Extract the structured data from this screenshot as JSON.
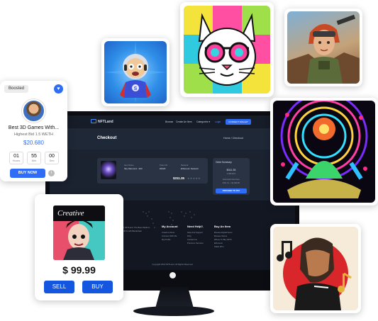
{
  "site": {
    "logo": "NFTLand",
    "nav": [
      "Browse",
      "Create An Item",
      "Categories ▾"
    ],
    "login": "Login",
    "connect": "CONNECT WALLET"
  },
  "checkout": {
    "title": "Checkout",
    "breadcrumb": "Home  /  Checkout",
    "item": {
      "col1_header": "Item Name",
      "col1_value": "Sky Diamond - 393",
      "col2_header": "Token ID",
      "col2_value": "#4420",
      "col3_header": "Network",
      "col3_value": "Ethereum Network",
      "price": "$311.35",
      "stars": "★★★★★"
    },
    "summary": {
      "title": "Order Summary",
      "amount": "$311.35",
      "amount_sub": "0.089 ETH",
      "note": "Estimated Gas Fees",
      "total": "ETH 0.1 + $1,999.99",
      "proceed": "PROCEED TO PAY"
    }
  },
  "footer": {
    "col1": {
      "text1": "Copyright 2022 NFTLand. The Best Platform",
      "text2": "To Buy & Sell NFTs with Blockchain",
      "text3": "Technology"
    },
    "col2": {
      "heading": "My Account",
      "links": [
        "Create A Store",
        "Connect With Me",
        "My Profile"
      ]
    },
    "col3": {
      "heading": "Need Help?",
      "links": [
        "Help And Support",
        "FAQ",
        "Contact Us",
        "Premium Services"
      ]
    },
    "col4": {
      "heading": "Buy An Item",
      "links": [
        "Browse Digital Items",
        "Browse Stores",
        "Where To Buy NFTs",
        "Ethereum",
        "Stake ETH"
      ]
    },
    "copyright": "Copyright 2022 NFTLand. All Rights Reserved"
  },
  "boosted_card": {
    "badge": "Boosted",
    "title": "Best 3D Games With...",
    "subtitle": "Highest Bid 1.5 WETH",
    "price": "$20.680",
    "timer": [
      {
        "value": "01",
        "unit": "Hours"
      },
      {
        "value": "55",
        "unit": "Min"
      },
      {
        "value": "00",
        "unit": "Sec"
      }
    ],
    "buy_now": "BUY NOW",
    "info": "i"
  },
  "price_card": {
    "art_caption": "Creative",
    "price": "$ 99.99",
    "sell": "SELL",
    "buy": "BUY"
  },
  "icons": {
    "heart": "heart-icon",
    "info": "info-icon"
  },
  "colors": {
    "accent": "#2f6df6",
    "buy_button": "#1456e0",
    "screen_bg": "#1b2230"
  }
}
